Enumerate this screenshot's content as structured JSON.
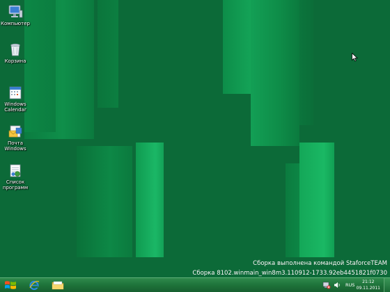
{
  "desktop": {
    "icons": [
      {
        "label": "Компьютер",
        "icon": "computer-icon"
      },
      {
        "label": "Корзина",
        "icon": "recycle-bin-icon"
      },
      {
        "label": "Windows Calendar",
        "icon": "calendar-icon"
      },
      {
        "label": "Почта Windows",
        "icon": "mail-icon"
      },
      {
        "label": "Список программ",
        "icon": "programs-list-icon"
      }
    ],
    "watermark": {
      "line1": "Сборка выполнена командой StaforceTEAM",
      "line2": "Сборка 8102.winmain_win8m3.110912-1733.92eb4451821f0730"
    }
  },
  "taskbar": {
    "pinned": [
      {
        "name": "Internet Explorer",
        "icon": "internet-explorer-icon"
      },
      {
        "name": "Windows Explorer",
        "icon": "folder-icon"
      }
    ],
    "tray": {
      "language": "RUS",
      "time": "21:12",
      "date": "09.11.2011"
    }
  },
  "colors": {
    "desktop_bg": "#0c6a38",
    "stripe_light": "#1ab864",
    "taskbar": "#1e733a"
  }
}
